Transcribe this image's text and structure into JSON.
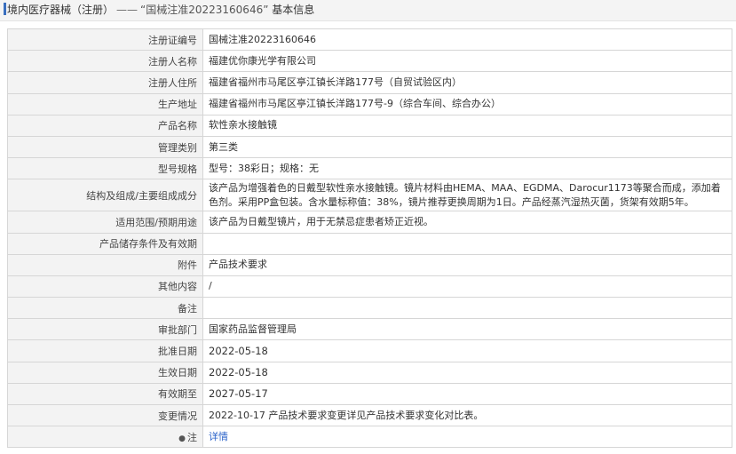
{
  "header": {
    "title": "境内医疗器械（注册）",
    "separator": "——",
    "record": "“国械注准20223160646”",
    "suffix": "基本信息"
  },
  "rows": [
    {
      "label": "注册证编号",
      "value": "国械注准20223160646"
    },
    {
      "label": "注册人名称",
      "value": "福建优你康光学有限公司"
    },
    {
      "label": "注册人住所",
      "value": "福建省福州市马尾区亭江镇长洋路177号（自贸试验区内）"
    },
    {
      "label": "生产地址",
      "value": "福建省福州市马尾区亭江镇长洋路177号-9（综合车间、综合办公）"
    },
    {
      "label": "产品名称",
      "value": "软性亲水接触镜"
    },
    {
      "label": "管理类别",
      "value": "第三类"
    },
    {
      "label": "型号规格",
      "value": "型号：38彩日；规格：无"
    },
    {
      "label": "结构及组成/主要组成成分",
      "value": "该产品为增强着色的日戴型软性亲水接触镜。镜片材料由HEMA、MAA、EGDMA、Darocur1173等聚合而成，添加着色剂。采用PP盒包装。含水量标称值：38%，镜片推荐更换周期为1日。产品经蒸汽湿热灭菌，货架有效期5年。"
    },
    {
      "label": "适用范围/预期用途",
      "value": "该产品为日戴型镜片，用于无禁忌症患者矫正近视。"
    },
    {
      "label": "产品储存条件及有效期",
      "value": ""
    },
    {
      "label": "附件",
      "value": "产品技术要求"
    },
    {
      "label": "其他内容",
      "value": "/"
    },
    {
      "label": "备注",
      "value": ""
    },
    {
      "label": "审批部门",
      "value": "国家药品监督管理局"
    },
    {
      "label": "批准日期",
      "value": "2022-05-18"
    },
    {
      "label": "生效日期",
      "value": "2022-05-18"
    },
    {
      "label": "有效期至",
      "value": "2027-05-17"
    },
    {
      "label": "变更情况",
      "value": "2022-10-17 产品技术要求变更详见产品技术要求变化对比表。"
    }
  ],
  "footer_row": {
    "label": "注",
    "icon": "pin-icon",
    "link_text": "详情"
  }
}
